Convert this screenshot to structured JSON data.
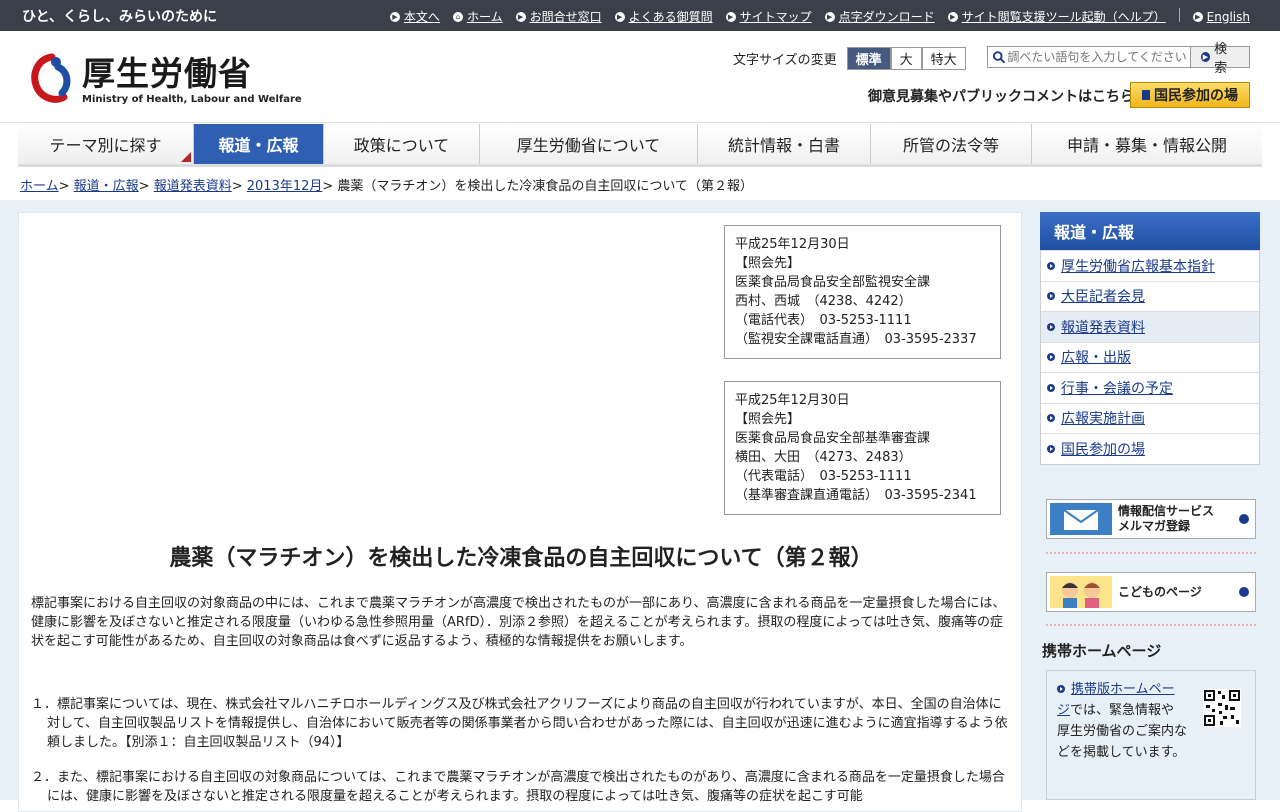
{
  "topbar": {
    "tagline": "ひと、くらし、みらいのために",
    "links": [
      "本文へ",
      "ホーム",
      "お問合せ窓口",
      "よくある御質問",
      "サイトマップ",
      "点字ダウンロード",
      "サイト閲覧支援ツール起動（ヘルプ）",
      "English"
    ]
  },
  "header": {
    "logo_jp": "厚生労働省",
    "logo_en": "Ministry of Health, Labour and Welfare",
    "fontsize_label": "文字サイズの変更",
    "fontsize_options": [
      "標準",
      "大",
      "特大"
    ],
    "search_placeholder": "調べたい語句を入力してください",
    "search_button": "検索",
    "pubcomment": "御意見募集やパブリックコメントはこちら",
    "kokumin_button": "国民参加の場"
  },
  "gnav": [
    "テーマ別に探す",
    "報道・広報",
    "政策について",
    "厚生労働省について",
    "統計情報・白書",
    "所管の法令等",
    "申請・募集・情報公開"
  ],
  "breadcrumb": {
    "links": [
      "ホーム",
      "報道・広報",
      "報道発表資料",
      "2013年12月"
    ],
    "current": "農薬（マラチオン）を検出した冷凍食品の自主回収について（第２報）"
  },
  "contacts": [
    {
      "date": "平成25年12月30日",
      "label": "【照会先】",
      "dept": "医薬食品局食品安全部監視安全課",
      "persons": "西村、西城　（4238、4242）",
      "phone1": "（電話代表）　03-5253-1111",
      "phone2": "（監視安全課電話直通）　03-3595-2337"
    },
    {
      "date": "平成25年12月30日",
      "label": "【照会先】",
      "dept": "医薬食品局食品安全部基準審査課",
      "persons": "横田、大田　（4273、2483）",
      "phone1": "（代表電話）　03-5253-1111",
      "phone2": "（基準審査課直通電話）　03-3595-2341"
    }
  ],
  "article": {
    "title": "農薬（マラチオン）を検出した冷凍食品の自主回収について（第２報）",
    "intro": "標記事案における自主回収の対象商品の中には、これまで農薬マラチオンが高濃度で検出されたものが一部にあり、高濃度に含まれる商品を一定量摂食した場合には、健康に影響を及ぼさないと推定される限度量（いわゆる急性参照用量（ARfD）．別添２参照）を超えることが考えられます。摂取の程度によっては吐き気、腹痛等の症状を起こす可能性があるため、自主回収の対象商品は食べずに返品するよう、積極的な情報提供をお願いします。",
    "item1": "１．標記事案については、現在、株式会社マルハニチロホールディングス及び株式会社アクリフーズにより商品の自主回収が行われていますが、本日、全国の自治体に対して、自主回収製品リストを情報提供し、自治体において販売者等の関係事業者から問い合わせがあった際には、自主回収が迅速に進むように適宜指導するよう依頼しました。【別添１：自主回収製品リスト（94）】",
    "item2": "２．また、標記事案における自主回収の対象商品については、これまで農薬マラチオンが高濃度で検出されたものがあり、高濃度に含まれる商品を一定量摂食した場合には、健康に影響を及ぼさないと推定される限度量を超えることが考えられます。摂取の程度によっては吐き気、腹痛等の症状を起こす可能"
  },
  "sidebar": {
    "heading": "報道・広報",
    "items": [
      "厚生労働省広報基本指針",
      "大臣記者会見",
      "報道発表資料",
      "広報・出版",
      "行事・会議の予定",
      "広報実施計画",
      "国民参加の場"
    ],
    "banner1": [
      "情報配信サービス",
      "メルマガ登録"
    ],
    "banner2": "こどものページ",
    "mobile_heading": "携帯ホームページ",
    "mobile_link": "携帯版ホームページ",
    "mobile_text": "では、緊急情報や厚生労働省のご案内などを掲載しています。"
  }
}
